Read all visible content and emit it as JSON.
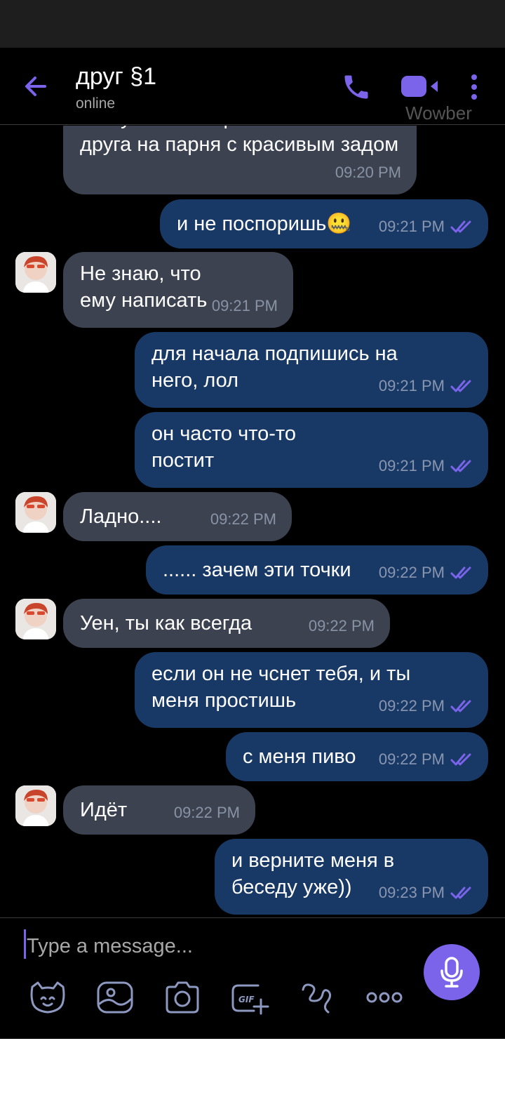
{
  "header": {
    "contact_name": "друг §1",
    "status": "online",
    "watermark": "Wowber"
  },
  "messages": [
    {
      "direction": "in",
      "text_top": "ты буквально променял",
      "text": "друга на парня с красивым задом",
      "time": "09:20 PM"
    },
    {
      "direction": "out",
      "text": "и не поспоришь🤐",
      "time": "09:21 PM"
    },
    {
      "direction": "in",
      "text": "Не знаю, что ему написать",
      "time": "09:21 PM"
    },
    {
      "direction": "out",
      "text": "для начала подпишись на него, лол",
      "time": "09:21 PM"
    },
    {
      "direction": "out",
      "text": "он часто что-то постит",
      "time": "09:21 PM"
    },
    {
      "direction": "in",
      "text": "Ладно....",
      "time": "09:22 PM"
    },
    {
      "direction": "out",
      "text": "...... зачем эти точки",
      "time": "09:22 PM"
    },
    {
      "direction": "in",
      "text": "Уен, ты как всегда",
      "time": "09:22 PM"
    },
    {
      "direction": "out",
      "text": "если он не чснет тебя, и ты меня простишь",
      "time": "09:22 PM"
    },
    {
      "direction": "out",
      "text": "с меня пиво",
      "time": "09:22 PM"
    },
    {
      "direction": "in",
      "text": "Идёт",
      "time": "09:22 PM"
    },
    {
      "direction": "out",
      "text": "и верните меня в беседу уже))",
      "time": "09:23 PM"
    }
  ],
  "composer": {
    "placeholder": "Type a message..."
  },
  "toolbar_icons": [
    "sticker-icon",
    "gallery-icon",
    "camera-icon",
    "gif-icon",
    "doodle-icon",
    "more-options-icon"
  ],
  "colors": {
    "accent": "#7b63ea",
    "incoming_bubble": "#3c4250",
    "outgoing_bubble": "#183966",
    "read_ticks": "#7b63ea"
  }
}
